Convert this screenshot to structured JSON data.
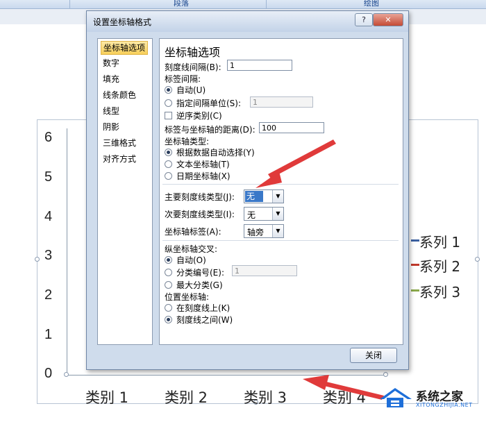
{
  "ribbon": {
    "groups": [
      "段落",
      "绘图"
    ]
  },
  "chart": {
    "y_ticks": [
      "6",
      "5",
      "4",
      "3",
      "2",
      "1",
      "0"
    ],
    "x_ticks": [
      "类别 1",
      "类别 2",
      "类别 3",
      "类别 4"
    ],
    "legend": [
      {
        "label": "系列 1",
        "color": "#3a5fa0"
      },
      {
        "label": "系列 2",
        "color": "#c0392b"
      },
      {
        "label": "系列 3",
        "color": "#8aa84a"
      }
    ]
  },
  "chart_data": {
    "type": "bar",
    "categories": [
      "类别 1",
      "类别 2",
      "类别 3",
      "类别 4"
    ],
    "series": [
      {
        "name": "系列 1",
        "values": []
      },
      {
        "name": "系列 2",
        "values": []
      },
      {
        "name": "系列 3",
        "values": []
      }
    ],
    "ylim": [
      0,
      6
    ],
    "legend": "right"
  },
  "dialog": {
    "title": "设置坐标轴格式",
    "help_label": "?",
    "close_label": "✕",
    "nav": [
      "坐标轴选项",
      "数字",
      "填充",
      "线条颜色",
      "线型",
      "阴影",
      "三维格式",
      "对齐方式"
    ],
    "panel_title": "坐标轴选项",
    "tick_interval_label": "刻度线间隔(B):",
    "tick_interval_value": "1",
    "label_interval_label": "标签间隔:",
    "auto_label": "自动(U)",
    "specify_interval_label": "指定间隔单位(S):",
    "specify_interval_value": "1",
    "reverse_label": "逆序类别(C)",
    "label_distance_label": "标签与坐标轴的距离(D):",
    "label_distance_value": "100",
    "axis_type_label": "坐标轴类型:",
    "axis_type_auto": "根据数据自动选择(Y)",
    "axis_type_text": "文本坐标轴(T)",
    "axis_type_date": "日期坐标轴(X)",
    "major_tick_label": "主要刻度线类型(J):",
    "major_tick_value": "无",
    "minor_tick_label": "次要刻度线类型(I):",
    "minor_tick_value": "无",
    "axis_labels_label": "坐标轴标签(A):",
    "axis_labels_value": "轴旁",
    "vertical_cross_label": "纵坐标轴交叉:",
    "cross_auto": "自动(O)",
    "cross_category": "分类编号(E):",
    "cross_category_value": "1",
    "cross_max": "最大分类(G)",
    "position_label": "位置坐标轴:",
    "position_on_tick": "在刻度线上(K)",
    "position_between": "刻度线之间(W)",
    "close_button": "关闭"
  },
  "watermark": {
    "line1": "系统之家",
    "line2": "XITONGZHIJIA.NET"
  }
}
